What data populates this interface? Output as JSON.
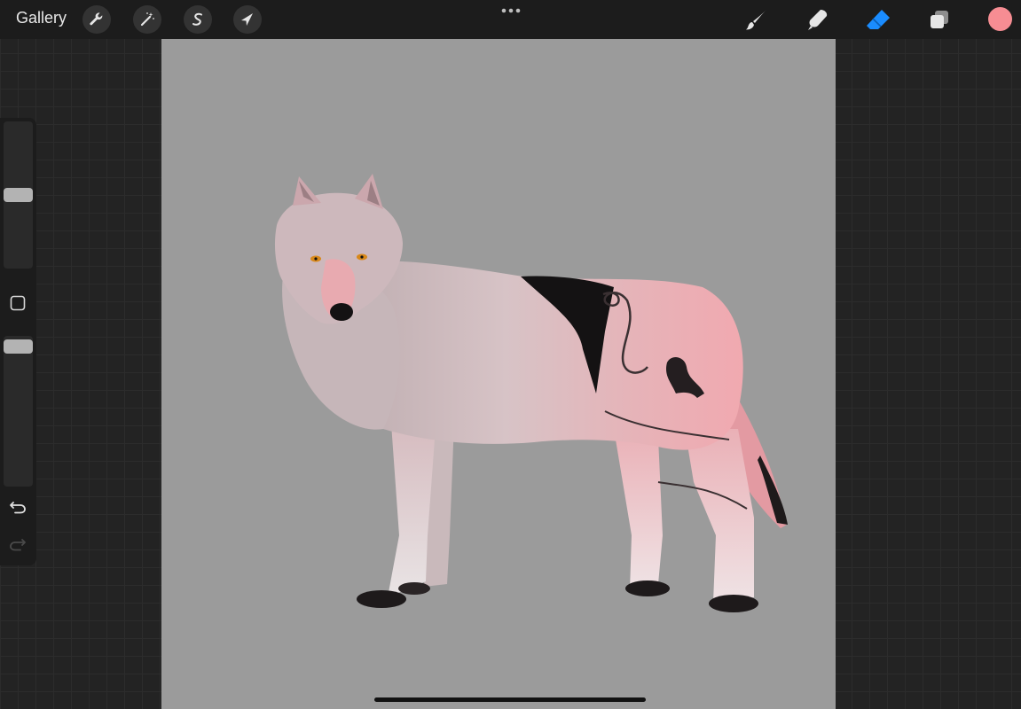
{
  "topbar": {
    "gallery_label": "Gallery",
    "left_tools": [
      {
        "name": "actions",
        "icon": "wrench-icon"
      },
      {
        "name": "adjustments",
        "icon": "magic-wand-icon"
      },
      {
        "name": "selection",
        "icon": "selection-s-icon"
      },
      {
        "name": "transform",
        "icon": "arrow-cursor-icon"
      }
    ],
    "more_icon": "more-dots-icon",
    "right_tools": [
      {
        "name": "brush",
        "icon": "brush-icon",
        "active": false
      },
      {
        "name": "smudge",
        "icon": "smudge-finger-icon",
        "active": false
      },
      {
        "name": "eraser",
        "icon": "eraser-icon",
        "active": true
      },
      {
        "name": "layers",
        "icon": "layers-icon",
        "active": false
      }
    ],
    "current_color": "#f78d93",
    "active_tool_color": "#1a8cff"
  },
  "sidebar": {
    "size_slider_icon": "size-slider",
    "opacity_slider_icon": "opacity-slider",
    "modify_button_icon": "square-modify-icon",
    "undo_icon": "undo-icon",
    "redo_icon": "redo-icon"
  },
  "canvas": {
    "background": "#9b9b9b",
    "artwork": "wolf-illustration"
  }
}
